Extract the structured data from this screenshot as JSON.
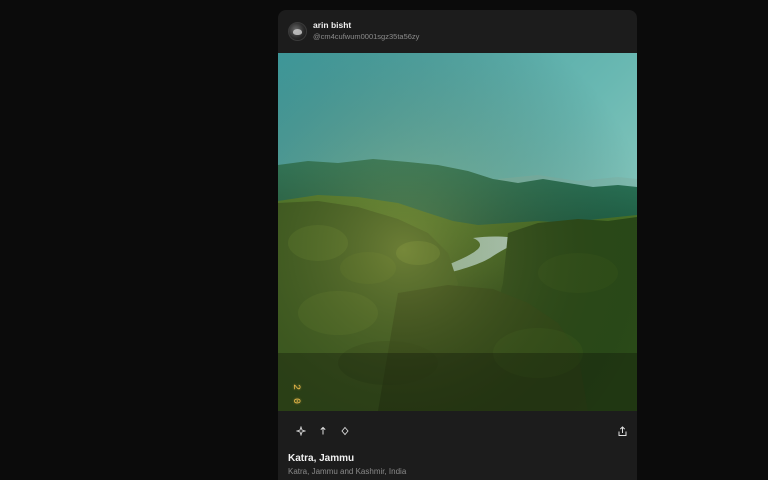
{
  "post": {
    "author": {
      "name": "arin bisht",
      "handle": "@cm4cufwum0001sgz35ta56zy",
      "avatar_icon": "avatar"
    },
    "photo": {
      "stamp": "2 0"
    },
    "actions": [
      {
        "icon": "sparkle-icon"
      },
      {
        "icon": "arrow-up-icon"
      },
      {
        "icon": "diamond-icon"
      }
    ],
    "share_icon": "share-icon",
    "location": {
      "title": "Katra, Jammu",
      "subtitle": "Katra, Jammu and Kashmir, India"
    }
  },
  "colors": {
    "page_background": "#0b0b0b",
    "card_background": "#1c1c1c",
    "stamp": "#e8b84a"
  }
}
